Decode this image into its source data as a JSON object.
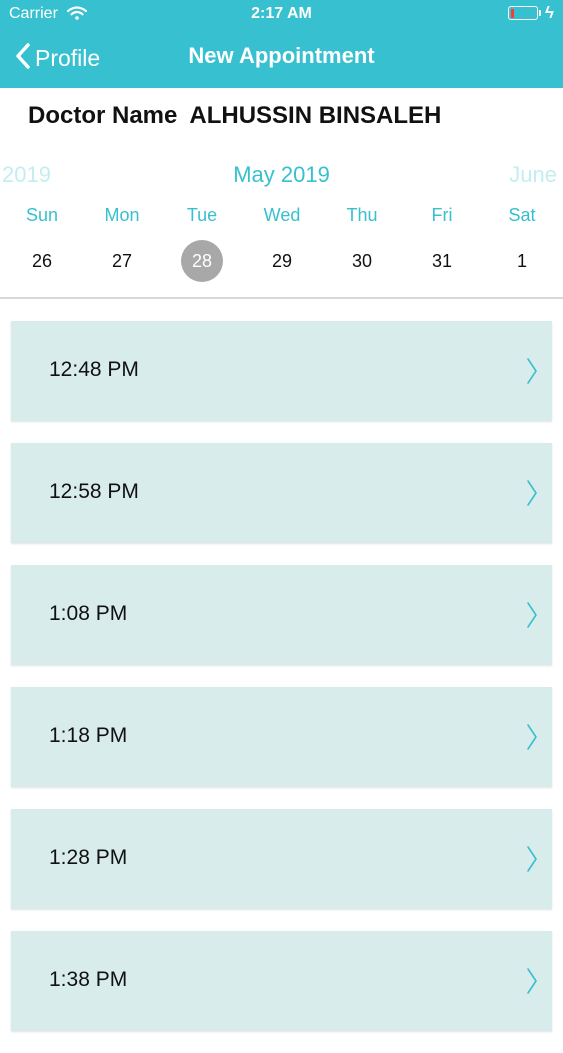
{
  "status_bar": {
    "carrier": "Carrier",
    "time": "2:17 AM",
    "battery_level": 0.12
  },
  "nav": {
    "back_label": "Profile",
    "title": "New Appointment"
  },
  "doctor": {
    "label": "Doctor Name",
    "name": "ALHUSSIN BINSALEH"
  },
  "calendar": {
    "prev_month": "2019",
    "current_month": "May 2019",
    "next_month": "June",
    "weekdays": [
      "Sun",
      "Mon",
      "Tue",
      "Wed",
      "Thu",
      "Fri",
      "Sat"
    ],
    "days": [
      "26",
      "27",
      "28",
      "29",
      "30",
      "31",
      "1"
    ],
    "selected_day": "28"
  },
  "time_slots": [
    "12:48 PM",
    "12:58 PM",
    "1:08 PM",
    "1:18 PM",
    "1:28 PM",
    "1:38 PM"
  ],
  "colors": {
    "accent": "#37c0cf",
    "slot_bg": "#d8ecec",
    "selected_day_bg": "#a8a8a8",
    "battery_low": "#ff3b30"
  }
}
